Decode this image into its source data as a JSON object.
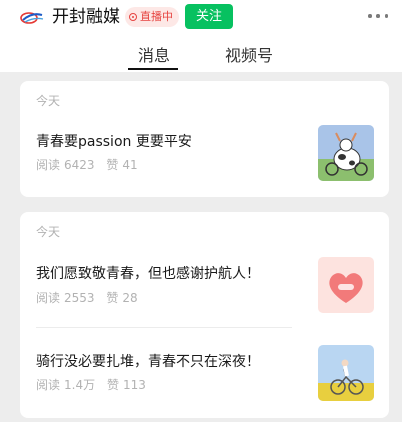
{
  "header": {
    "account_name": "开封融媒",
    "live_badge": "直播中",
    "follow_label": "关注",
    "more_icon": "more-icon",
    "logo_icon": "logo-icon"
  },
  "tabs": [
    {
      "label": "消息",
      "active": true
    },
    {
      "label": "视频号",
      "active": false
    }
  ],
  "colors": {
    "accent": "#07c160",
    "live": "#e64340",
    "background": "#ededed"
  },
  "feed": [
    {
      "date": "今天",
      "articles": [
        {
          "title": "青春要passion 更要平安",
          "reads_label": "阅读",
          "reads": "6423",
          "likes_label": "赞",
          "likes": "41",
          "thumbnail": "cartoon-cow-illustration"
        }
      ]
    },
    {
      "date": "今天",
      "articles": [
        {
          "title": "我们愿致敬青春，但也感谢护航人！",
          "reads_label": "阅读",
          "reads": "2553",
          "likes_label": "赞",
          "likes": "28",
          "thumbnail": "pink-heart-illustration"
        },
        {
          "title": "骑行没必要扎堆，青春不只在深夜！",
          "reads_label": "阅读",
          "reads": "1.4万",
          "likes_label": "赞",
          "likes": "113",
          "thumbnail": "cyclist-flower-field-photo"
        }
      ]
    }
  ]
}
